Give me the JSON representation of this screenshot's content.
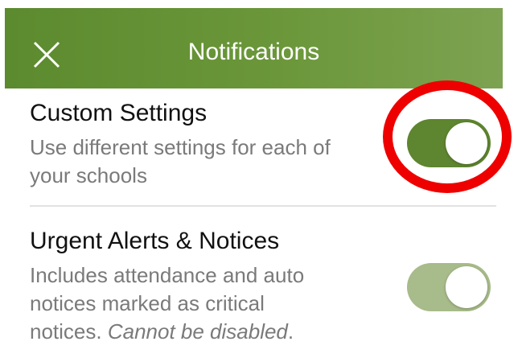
{
  "header": {
    "title": "Notifications",
    "close_icon": "close-icon",
    "background": "#6b973a"
  },
  "custom_settings": {
    "title": "Custom Settings",
    "description_line1": "Use different settings for each of",
    "description_line2": "your schools",
    "toggle_on": true
  },
  "urgent_alerts": {
    "title": "Urgent Alerts & Notices",
    "description_line1": "Includes attendance and auto",
    "description_line2": "notices marked as critical",
    "description_line3_prefix": "notices. ",
    "description_line3_emphasis": "Cannot be disabled",
    "description_line3_suffix": ".",
    "toggle_on": true,
    "toggle_enabled": false
  },
  "colors": {
    "accent": "#5e852f",
    "disabled_accent": "#a8bb8a",
    "highlight": "#ee0000"
  }
}
